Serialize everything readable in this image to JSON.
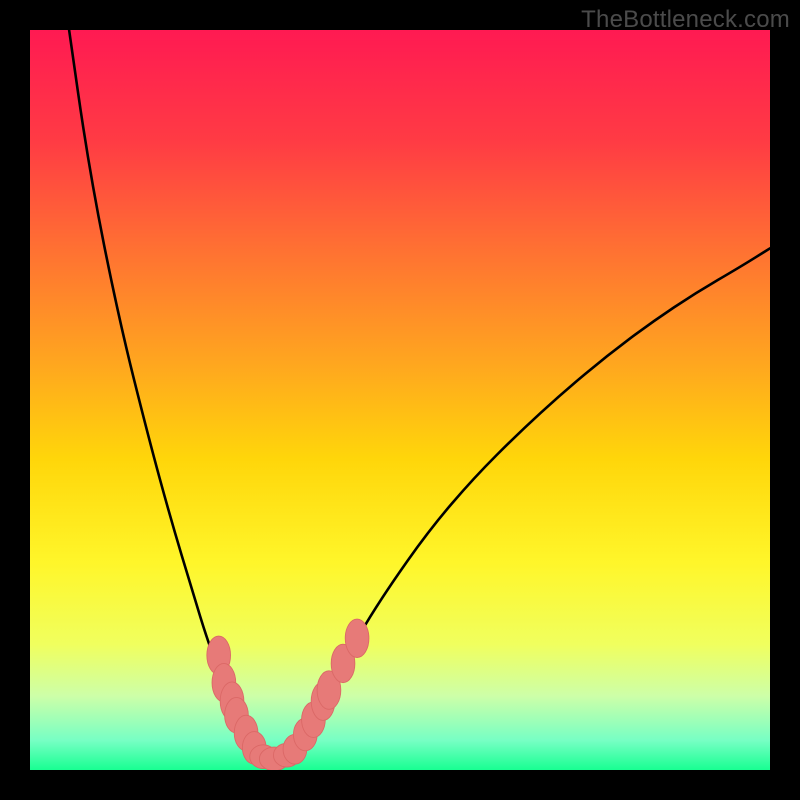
{
  "watermark": "TheBottleneck.com",
  "colors": {
    "border": "#000000",
    "curve": "#000000",
    "marker_fill": "#e77a78",
    "marker_stroke": "#db6866",
    "gradient_stops": [
      {
        "offset": 0.0,
        "color": "#ff1a52"
      },
      {
        "offset": 0.15,
        "color": "#ff3b44"
      },
      {
        "offset": 0.3,
        "color": "#ff7232"
      },
      {
        "offset": 0.45,
        "color": "#ffa61f"
      },
      {
        "offset": 0.58,
        "color": "#ffd60a"
      },
      {
        "offset": 0.72,
        "color": "#fff62a"
      },
      {
        "offset": 0.83,
        "color": "#f0ff5e"
      },
      {
        "offset": 0.9,
        "color": "#cdffa8"
      },
      {
        "offset": 0.96,
        "color": "#77ffc4"
      },
      {
        "offset": 1.0,
        "color": "#18ff92"
      }
    ]
  },
  "chart_data": {
    "type": "line",
    "title": "",
    "xlabel": "",
    "ylabel": "",
    "xlim": [
      0,
      100
    ],
    "ylim": [
      0,
      100
    ],
    "series": [
      {
        "name": "curve",
        "x": [
          5,
          8,
          12,
          16,
          19,
          22,
          24,
          26,
          27.5,
          29,
          30,
          31,
          32,
          33,
          34.5,
          36,
          38,
          40,
          44,
          48,
          54,
          60,
          66,
          72,
          78,
          84,
          90,
          96,
          100
        ],
        "y": [
          102,
          81,
          61,
          45,
          34,
          24,
          17.5,
          12,
          8.5,
          5.5,
          3.5,
          2.2,
          1.5,
          1.4,
          1.8,
          3.2,
          6.2,
          10,
          17.5,
          24,
          32.5,
          39.5,
          45.5,
          51,
          56,
          60.5,
          64.5,
          68,
          70.5
        ]
      }
    ],
    "markers": [
      {
        "x": 25.5,
        "y": 15.5,
        "rx": 1.6,
        "ry": 2.6
      },
      {
        "x": 26.2,
        "y": 11.8,
        "rx": 1.6,
        "ry": 2.6
      },
      {
        "x": 27.3,
        "y": 9.3,
        "rx": 1.6,
        "ry": 2.6
      },
      {
        "x": 27.9,
        "y": 7.4,
        "rx": 1.6,
        "ry": 2.4
      },
      {
        "x": 29.2,
        "y": 5.0,
        "rx": 1.6,
        "ry": 2.4
      },
      {
        "x": 30.3,
        "y": 3.0,
        "rx": 1.6,
        "ry": 2.2
      },
      {
        "x": 31.5,
        "y": 1.8,
        "rx": 1.8,
        "ry": 1.6
      },
      {
        "x": 33.0,
        "y": 1.5,
        "rx": 2.0,
        "ry": 1.6
      },
      {
        "x": 34.7,
        "y": 2.0,
        "rx": 1.8,
        "ry": 1.6
      },
      {
        "x": 35.8,
        "y": 2.8,
        "rx": 1.6,
        "ry": 2.0
      },
      {
        "x": 37.2,
        "y": 4.8,
        "rx": 1.6,
        "ry": 2.2
      },
      {
        "x": 38.3,
        "y": 6.8,
        "rx": 1.6,
        "ry": 2.4
      },
      {
        "x": 39.6,
        "y": 9.3,
        "rx": 1.6,
        "ry": 2.6
      },
      {
        "x": 40.4,
        "y": 10.8,
        "rx": 1.6,
        "ry": 2.6
      },
      {
        "x": 42.3,
        "y": 14.4,
        "rx": 1.6,
        "ry": 2.6
      },
      {
        "x": 44.2,
        "y": 17.8,
        "rx": 1.6,
        "ry": 2.6
      }
    ]
  }
}
